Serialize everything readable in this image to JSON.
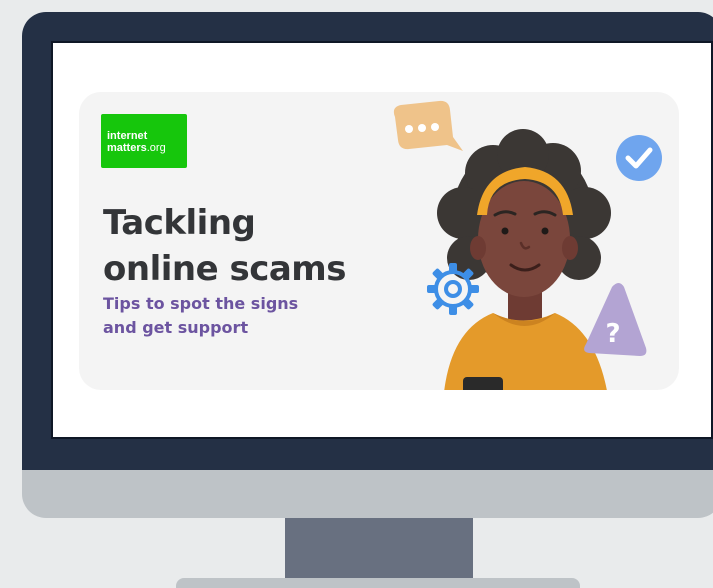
{
  "logo": {
    "line1": "internet",
    "line2": "matters",
    "line2_suffix": ".org"
  },
  "headline": {
    "line1": "Tackling",
    "line2": "online scams"
  },
  "subheadline": {
    "line1": "Tips to spot the signs",
    "line2": "and get support"
  },
  "colors": {
    "monitor_frame": "#243045",
    "monitor_chin": "#bec3c7",
    "brand_green": "#16c60c",
    "headline": "#333538",
    "subheadline": "#6c54a0",
    "shirt": "#e49a2a",
    "headband": "#f0a62a",
    "check_badge": "#6fa5ee",
    "warning_triangle": "#b3a4d3",
    "gear": "#3d8ee6",
    "speech_bubble": "#efc38a"
  },
  "icons": [
    "check-circle-icon",
    "speech-bubble-icon",
    "gear-icon",
    "question-warning-icon"
  ]
}
